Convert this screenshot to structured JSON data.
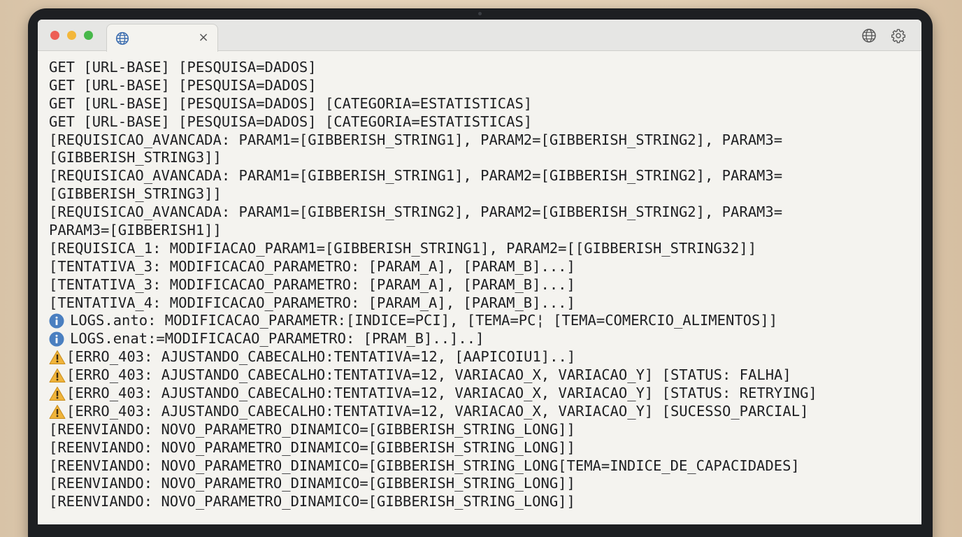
{
  "browser": {
    "tab_title": "",
    "close_glyph": "×",
    "traffic_lights": {
      "close": "#ed5e55",
      "minimize": "#f3b73b",
      "zoom": "#47b84a"
    },
    "icons": [
      "globe-icon",
      "globe-icon",
      "gear-icon"
    ]
  },
  "log": {
    "colors": {
      "text": "#1e1f22",
      "info": "#4a7fc0",
      "warning": "#f0b43a"
    },
    "lines": [
      {
        "type": "plain",
        "text": "GET [URL-BASE] [PESQUISA=DADOS]"
      },
      {
        "type": "plain",
        "text": "GET [URL-BASE] [PESQUISA=DADOS]"
      },
      {
        "type": "plain",
        "text": "GET [URL-BASE] [PESQUISA=DADOS] [CATEGORIA=ESTATISTICAS]"
      },
      {
        "type": "plain",
        "text": "GET [URL-BASE] [PESQUISA=DADOS] [CATEGORIA=ESTATISTICAS]"
      },
      {
        "type": "plain",
        "text": "[REQUISICAO_AVANCADA: PARAM1=[GIBBERISH_STRING1], PARAM2=[GIBBERISH_STRING2], PARAM3="
      },
      {
        "type": "plain",
        "text": "[GIBBERISH_STRING3]]"
      },
      {
        "type": "plain",
        "text": "[REQUISICAO_AVANCADA: PARAM1=[GIBBERISH_STRING1], PARAM2=[GIBBERISH_STRING2], PARAM3="
      },
      {
        "type": "plain",
        "text": "[GIBBERISH_STRING3]]"
      },
      {
        "type": "plain",
        "text": "[REQUISICAO_AVANCADA: PARAM1=[GIBBERISH_STRING2], PARAM2=[GIBBERISH_STRING2], PARAM3="
      },
      {
        "type": "plain",
        "text": "PARAM3=[GIBBERISH1]]"
      },
      {
        "type": "plain",
        "text": "[REQUISICA_1: MODIFIACAO_PARAM1=[GIBBERISH_STRING1], PARAM2=[[GIBBERISH_STRING32]]"
      },
      {
        "type": "plain",
        "text": "[TENTATIVA_3: MODIFICACAO_PARAMETRO: [PARAM_A], [PARAM_B]...]"
      },
      {
        "type": "plain",
        "text": "[TENTATIVA_3: MODIFICACAO_PARAMETRO: [PARAM_A], [PARAM_B]...]"
      },
      {
        "type": "plain",
        "text": "[TENTATIVA_4: MODIFICACAO_PARAMETRO: [PARAM_A], [PARAM_B]...]"
      },
      {
        "type": "info",
        "text": "LOGS.anto: MODIFICACAO_PARAMETR:[INDICE=PCI], [TEMA=PC¦ [TEMA=COMERCIO_ALIMENTOS]]"
      },
      {
        "type": "info",
        "text": "LOGS.enat:=MODIFICACAO_PARAMETRO: [PRAM_B]..]..]"
      },
      {
        "type": "warning",
        "text": "[ERRO_403: AJUSTANDO_CABECALHO:TENTATIVA=12, [AAPICOIU1]..]"
      },
      {
        "type": "warning",
        "text": "[ERRO_403: AJUSTANDO_CABECALHO:TENTATIVA=12, VARIACAO_X, VARIACAO_Y] [STATUS: FALHA]"
      },
      {
        "type": "warning",
        "text": "[ERRO_403: AJUSTANDO_CABECALHO:TENTATIVA=12, VARIACAO_X, VARIACAO_Y] [STATUS: RETRYING]"
      },
      {
        "type": "warning",
        "text": "[ERRO_403: AJUSTANDO_CABECALHO:TENTATIVA=12, VARIACAO_X, VARIACAO_Y] [SUCESSO_PARCIAL]"
      },
      {
        "type": "plain",
        "text": "[REENVIANDO: NOVO_PARAMETRO_DINAMICO=[GIBBERISH_STRING_LONG]]"
      },
      {
        "type": "plain",
        "text": "[REENVIANDO: NOVO_PARAMETRO_DINAMICO=[GIBBERISH_STRING_LONG]]"
      },
      {
        "type": "plain",
        "text": "[REENVIANDO: NOVO_PARAMETRO_DINAMICO=[GIBBERISH_STRING_LONG[TEMA=INDICE_DE_CAPACIDADES]"
      },
      {
        "type": "plain",
        "text": "[REENVIANDO: NOVO_PARAMETRO_DINAMICO=[GIBBERISH_STRING_LONG]]"
      },
      {
        "type": "plain",
        "text": "[REENVIANDO: NOVO_PARAMETRO_DINAMICO=[GIBBERISH_STRING_LONG]]"
      }
    ]
  }
}
